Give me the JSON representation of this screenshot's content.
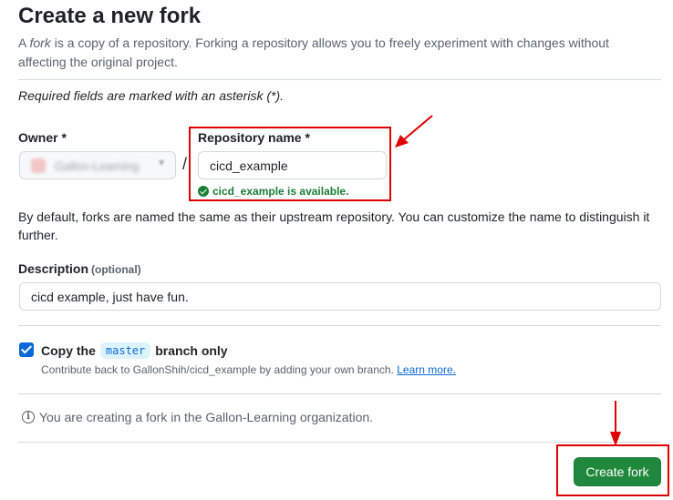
{
  "header": {
    "title": "Create a new fork",
    "desc_before": "A ",
    "desc_em": "fork",
    "desc_after": " is a copy of a repository. Forking a repository allows you to freely experiment with changes without affecting the original project."
  },
  "required_note": "Required fields are marked with an asterisk (*).",
  "owner": {
    "label": "Owner *",
    "value": "Gallon-Learning",
    "caret_icon": "chevron-down-icon"
  },
  "separator": "/",
  "repository": {
    "label": "Repository name *",
    "value": "cicd_example",
    "availability": "cicd_example is available."
  },
  "name_hint": "By default, forks are named the same as their upstream repository. You can customize the name to distinguish it further.",
  "description": {
    "label": "Description",
    "optional": "(optional)",
    "value": "cicd example, just have fun."
  },
  "copy_branch": {
    "checked": true,
    "label_before": "Copy the",
    "branch": "master",
    "label_after": "branch only",
    "help_text": "Contribute back to GallonShih/cicd_example by adding your own branch.",
    "learn_more": "Learn more."
  },
  "info": {
    "icon": "info-icon",
    "text": "You are creating a fork in the Gallon-Learning organization."
  },
  "create_button": {
    "label": "Create fork"
  },
  "colors": {
    "annotation_red": "#e00000",
    "primary_green": "#1f883d",
    "success_green": "#1a7f37",
    "link_blue": "#0969da"
  }
}
